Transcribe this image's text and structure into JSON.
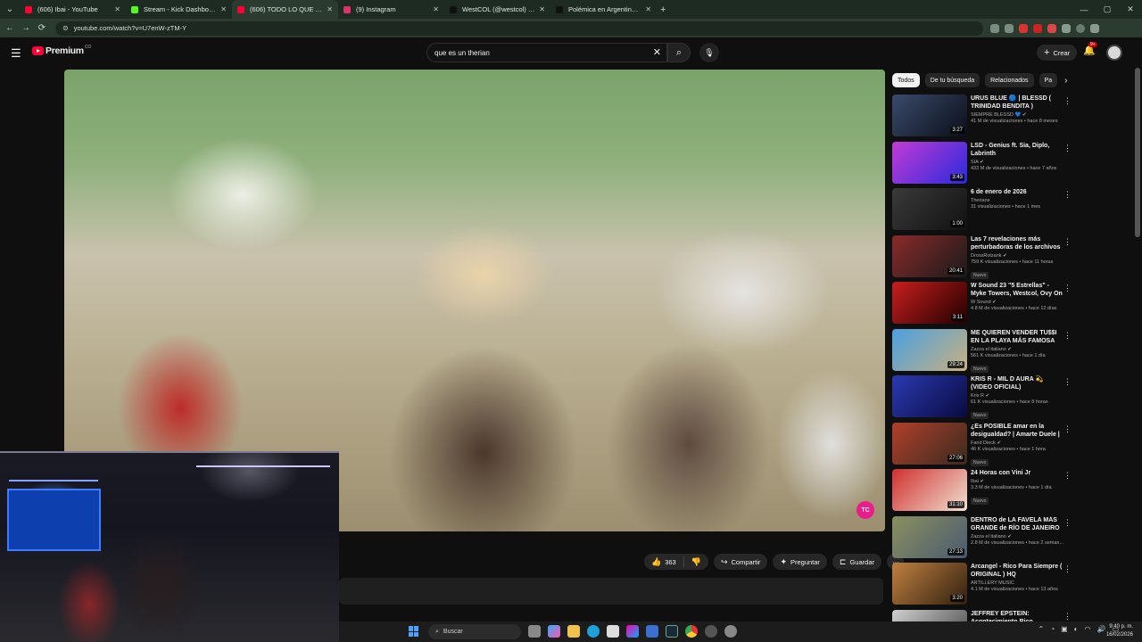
{
  "browser": {
    "tabs": [
      {
        "label": "(606) Ibai - YouTube",
        "color": "#ff0033",
        "active": false
      },
      {
        "label": "Stream - Kick Dashboard",
        "color": "#53fc18",
        "active": false
      },
      {
        "label": "(606) TODO LO QUE TIENES que...",
        "color": "#ff0033",
        "active": true
      },
      {
        "label": "(9) Instagram",
        "color": "#e1306c",
        "active": false
      },
      {
        "label": "WestCOL (@westcol) | TikTok",
        "color": "#111111",
        "active": false
      },
      {
        "label": "Polémica en Argentina: Jóvenes...",
        "color": "#111111",
        "active": false
      }
    ],
    "url": "youtube.com/watch?v=U7enW-zTM-Y"
  },
  "header": {
    "brand": "Premium",
    "brand_sup": "CO",
    "search_value": "que es un therian",
    "create_label": "Crear",
    "notif_count": "9+"
  },
  "video": {
    "watermark": "TC",
    "likes": "363",
    "share_label": "Compartir",
    "ask_label": "Preguntar",
    "save_label": "Guardar"
  },
  "chips": [
    "Todos",
    "De tu búsqueda",
    "Relacionados",
    "Pa"
  ],
  "recommendations": [
    {
      "title": "URUS BLUE 🔵 | BLESSD ( TRINIDAD BENDITA )",
      "channel": "SIEMPRE BLESSD 💙 ✔",
      "meta": "41 M de visualizaciones • hace 8 meses",
      "duration": "3:27",
      "badge": "",
      "c1": "#3a4a6a",
      "c2": "#0a0f1a"
    },
    {
      "title": "LSD - Genius ft. Sia, Diplo, Labrinth",
      "channel": "SIA ✔",
      "meta": "433 M de visualizaciones • hace 7 años",
      "duration": "3:43",
      "badge": "",
      "c1": "#c23bd6",
      "c2": "#2a2adb"
    },
    {
      "title": "6 de enero de 2026",
      "channel": "Therians",
      "meta": "31 visualizaciones • hace 1 mes",
      "duration": "1:00",
      "badge": "",
      "c1": "#3a3a3a",
      "c2": "#111111"
    },
    {
      "title": "Las 7 revelaciones más perturbadoras de los archivos ...",
      "channel": "DrossRotzank ✔",
      "meta": "759 K visualizaciones • hace 11 horas",
      "duration": "20:41",
      "badge": "Nuevo",
      "c1": "#8a2a2a",
      "c2": "#1a1a1a"
    },
    {
      "title": "W Sound 23 \"5 Estrellas\" - Myke Towers, Westcol, Ovy On The ...",
      "channel": "W Sound ✔",
      "meta": "4.8 M de visualizaciones • hace 12 días",
      "duration": "3:11",
      "badge": "",
      "c1": "#c81e1e",
      "c2": "#220000"
    },
    {
      "title": "ME QUIEREN VENDER TU$$I EN LA PLAYA MÁS FAMOSA DEL ...",
      "channel": "Zazza el italiano ✔",
      "meta": "561 K visualizaciones • hace 1 día",
      "duration": "29:24",
      "badge": "Nuevo",
      "c1": "#4aa0e0",
      "c2": "#c8b080"
    },
    {
      "title": "KRIS R - MIL D AURA 💫 (VIDEO OFICIAL)",
      "channel": "Kris R ✔",
      "meta": "61 K visualizaciones • hace 8 horas",
      "duration": "",
      "badge": "Nuevo",
      "c1": "#2a3ab0",
      "c2": "#0a0a40"
    },
    {
      "title": "¿Es POSIBLE amar en la desigualdad? | Amarte Duele | ...",
      "channel": "Farid Dieck ✔",
      "meta": "46 K visualizaciones • hace 1 hora",
      "duration": "27:06",
      "badge": "Nuevo",
      "c1": "#b0402a",
      "c2": "#3a2a20"
    },
    {
      "title": "24 Horas con Vini Jr",
      "channel": "Ibai ✔",
      "meta": "3.3 M de visualizaciones • hace 1 día",
      "duration": "31:10",
      "badge": "Nuevo",
      "c1": "#d03030",
      "c2": "#f0e0d0"
    },
    {
      "title": "DENTRO de LA FAVELA MÁS GRANDE de RÍO DE JANEIRO ...",
      "channel": "Zazza el italiano ✔",
      "meta": "2.8 M de visualizaciones • hace 2 seman...",
      "duration": "27:13",
      "badge": "",
      "c1": "#8a9060",
      "c2": "#4a5a70"
    },
    {
      "title": "Arcangel - Rico Para Siempre ( ORIGINAL ) HQ",
      "channel": "ARTILLERY MUSIC",
      "meta": "4.1 M de visualizaciones • hace 13 años",
      "duration": "3:20",
      "badge": "",
      "c1": "#c08040",
      "c2": "#302010"
    },
    {
      "title": "JEFFREY EPSTEIN: Acontecimiento Rico...",
      "channel": "",
      "meta": "",
      "duration": "",
      "badge": "",
      "c1": "#d0d0d0",
      "c2": "#404040"
    }
  ],
  "taskbar": {
    "search_placeholder": "Buscar",
    "time": "9:40 p. m.",
    "date": "16/02/2026"
  }
}
